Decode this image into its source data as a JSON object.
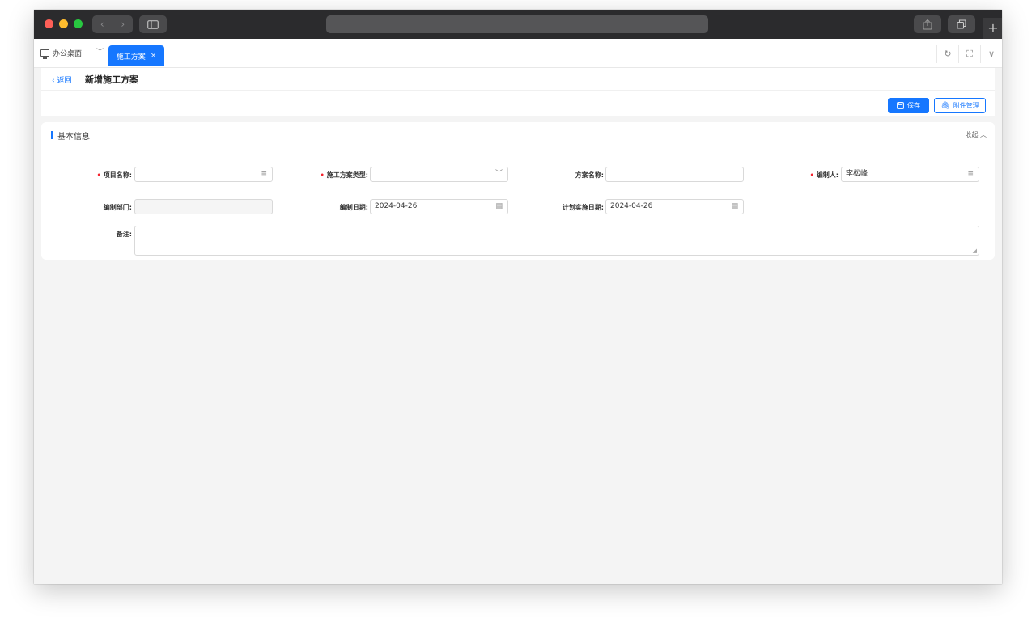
{
  "browser": {
    "nav_back": "‹",
    "nav_forward": "›",
    "new_tab": "+"
  },
  "tabs": {
    "home_label": "办公桌面",
    "active_label": "施工方案",
    "close": "×"
  },
  "header": {
    "back_label": "返回",
    "title": "新增施工方案"
  },
  "toolbar": {
    "save_label": "保存",
    "attach_label": "附件管理"
  },
  "section": {
    "title": "基本信息",
    "collapse_label": "收起 ︿"
  },
  "form": {
    "project_name_label": "项目名称:",
    "plan_type_label": "施工方案类型:",
    "plan_name_label": "方案名称:",
    "author_label": "编制人:",
    "author_value": "李松峰",
    "dept_label": "编制部门:",
    "date_label": "编制日期:",
    "date_value": "2024-04-26",
    "planned_date_label": "计划实施日期:",
    "planned_date_value": "2024-04-26",
    "remark_label": "备注:"
  },
  "colors": {
    "accent": "#1677ff",
    "required": "#f5222d"
  }
}
